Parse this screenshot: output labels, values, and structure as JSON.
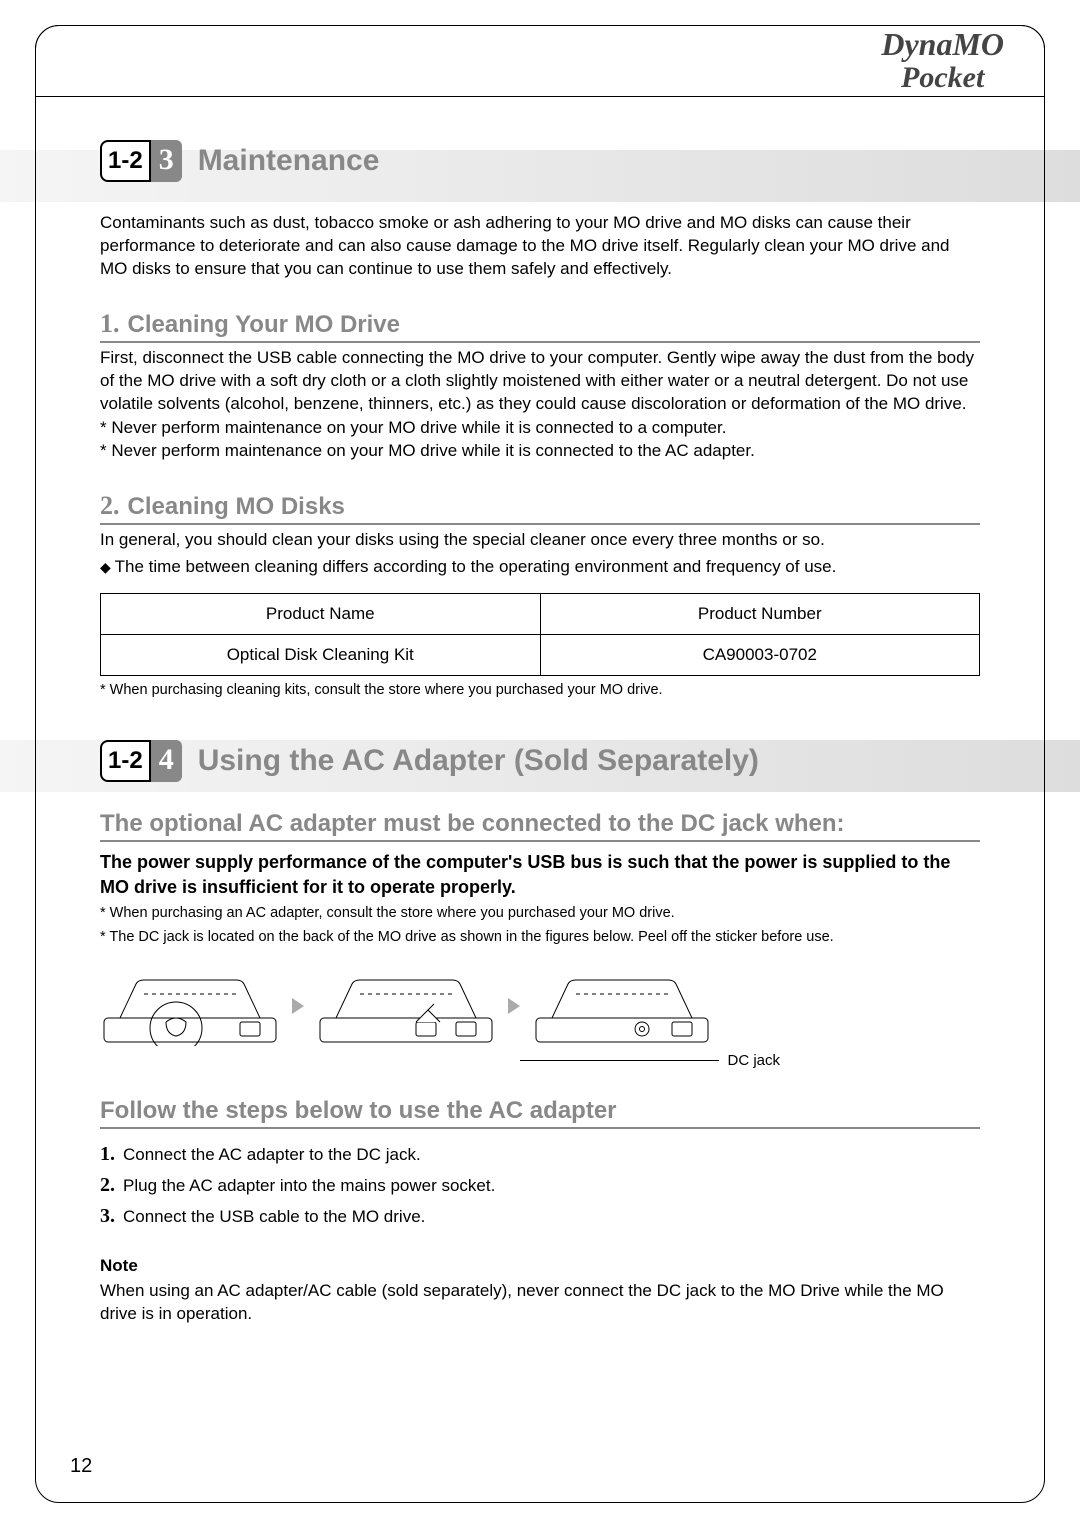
{
  "brand": {
    "top": "DynaMO",
    "bottom": "Pocket"
  },
  "page_number": "12",
  "section3": {
    "badge_chapter": "1-2",
    "badge_number": "3",
    "title": "Maintenance",
    "intro": "Contaminants such as dust, tobacco smoke or ash adhering to your MO drive and MO disks can cause their performance to deteriorate and can also cause damage to the MO drive itself. Regularly clean your MO drive and MO disks to ensure that you can continue to use them safely and effectively.",
    "sub1": {
      "num": "1.",
      "title": "Cleaning Your MO Drive",
      "body": "First, disconnect the USB cable connecting the MO drive to your computer. Gently wipe away the dust from the body of the MO drive with a soft dry cloth or a cloth slightly moistened with either water or a neutral detergent. Do not use volatile solvents (alcohol, benzene, thinners, etc.) as they could cause discoloration or deformation of the MO drive.",
      "star1": "* Never perform maintenance on your MO drive while it is connected to a computer.",
      "star2": "* Never perform maintenance on your MO drive while it is connected to the AC adapter."
    },
    "sub2": {
      "num": "2.",
      "title": "Cleaning MO Disks",
      "body": "In general, you should clean your disks using the special cleaner once every three months or so.",
      "bullet": "The time between cleaning differs according to the operating environment and frequency of use.",
      "table_h1": "Product Name",
      "table_h2": "Product Number",
      "table_c1": "Optical Disk Cleaning Kit",
      "table_c2": "CA90003-0702",
      "foot": "* When purchasing cleaning kits, consult the store where you purchased your MO drive."
    }
  },
  "section4": {
    "badge_chapter": "1-2",
    "badge_number": "4",
    "title": "Using the AC Adapter (Sold Separately)",
    "heading1": "The optional AC adapter must be connected to the DC jack when:",
    "bold_para": "The power supply performance of the computer's USB bus is such that the power is supplied to the MO drive is insufficient for it to operate properly.",
    "small1": "* When purchasing an AC adapter, consult the store where you purchased your MO drive.",
    "small2": "* The DC jack is located on the back of the MO drive as shown in the figures below. Peel off the sticker before use.",
    "dcjack_label": "DC jack",
    "heading2": "Follow the steps below to use the AC adapter",
    "steps": {
      "n1": "1.",
      "t1": "Connect the AC adapter to the DC jack.",
      "n2": "2.",
      "t2": "Plug the AC adapter into the mains power socket.",
      "n3": "3.",
      "t3": "Connect the USB cable to the MO drive."
    },
    "note_title": "Note",
    "note_body": "When using an AC adapter/AC cable (sold separately), never connect the DC jack to the MO Drive while the MO drive is in operation."
  }
}
